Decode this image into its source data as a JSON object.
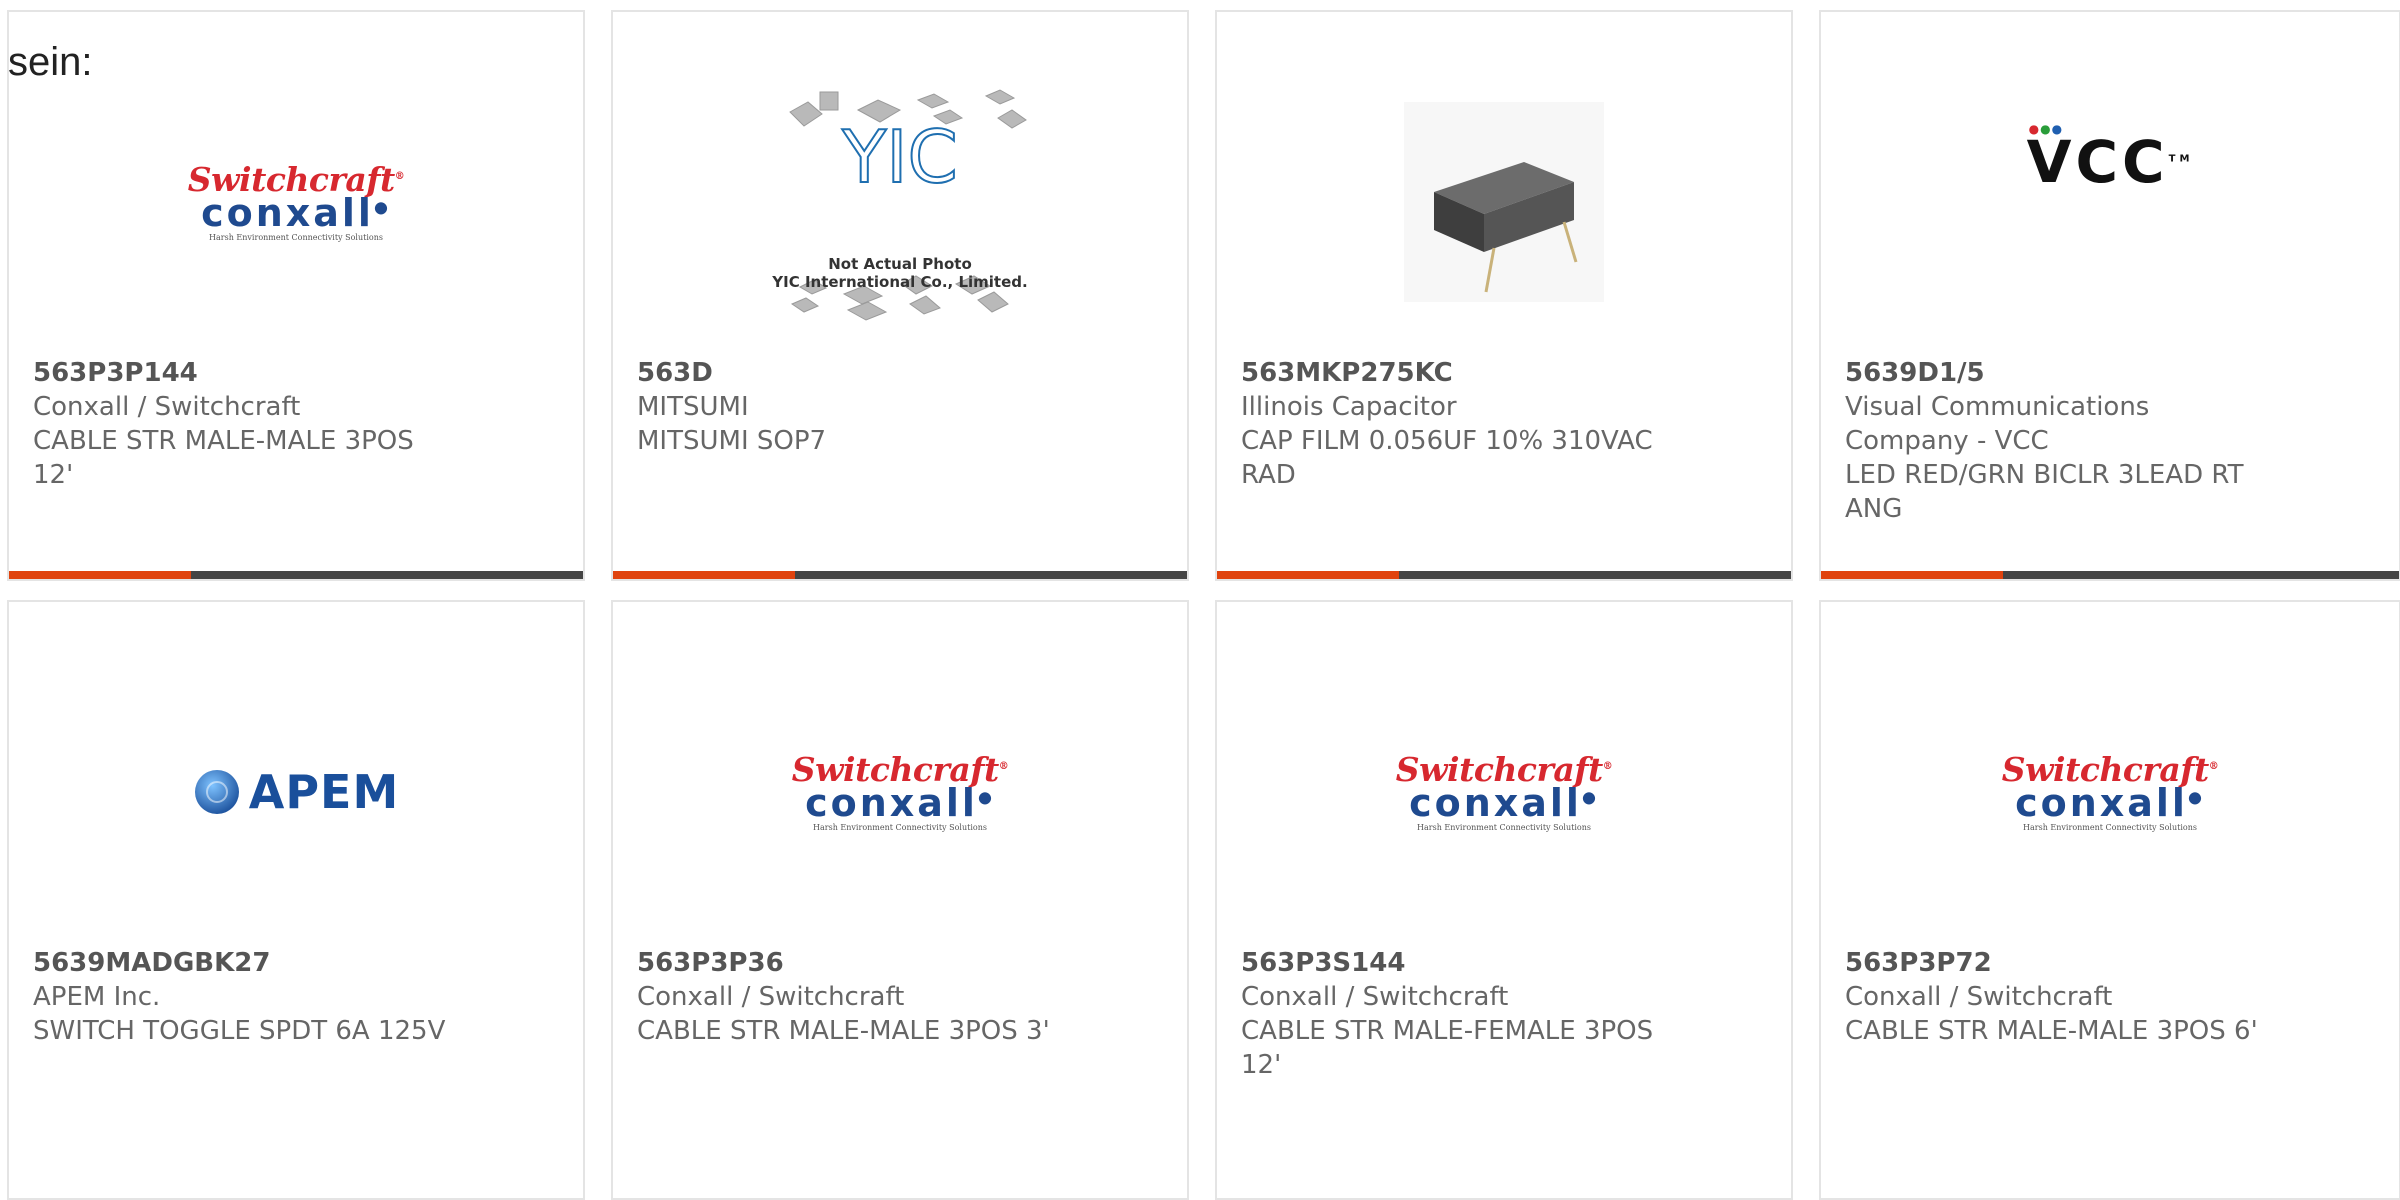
{
  "intro_text": "sein:",
  "products": [
    {
      "part": "563P3P144",
      "manufacturer": "Conxall / Switchcraft",
      "description": "CABLE STR MALE-MALE 3POS 12'",
      "logo": "switchcraft-conxall-logo"
    },
    {
      "part": "563D",
      "manufacturer": "MITSUMI",
      "description": "MITSUMI SOP7",
      "logo": "yic-placeholder-image"
    },
    {
      "part": "563MKP275KC",
      "manufacturer": "Illinois Capacitor",
      "description": "CAP FILM 0.056UF 10% 310VAC RAD",
      "logo": "film-capacitor-photo"
    },
    {
      "part": "5639D1/5",
      "manufacturer": "Visual Communications Company - VCC",
      "description": "LED RED/GRN BICLR 3LEAD RT ANG",
      "logo": "vcc-logo"
    },
    {
      "part": "5639MADGBK27",
      "manufacturer": "APEM Inc.",
      "description": "SWITCH TOGGLE SPDT 6A 125V",
      "logo": "apem-logo"
    },
    {
      "part": "563P3P36",
      "manufacturer": "Conxall / Switchcraft",
      "description": "CABLE STR MALE-MALE 3POS 3'",
      "logo": "switchcraft-conxall-logo"
    },
    {
      "part": "563P3S144",
      "manufacturer": "Conxall / Switchcraft",
      "description": "CABLE STR MALE-FEMALE 3POS 12'",
      "logo": "switchcraft-conxall-logo"
    },
    {
      "part": "563P3P72",
      "manufacturer": "Conxall / Switchcraft",
      "description": "CABLE STR MALE-MALE 3POS 6'",
      "logo": "switchcraft-conxall-logo"
    }
  ],
  "logos": {
    "switchcraft": {
      "line1": "Switchcraft",
      "line2": "conxall",
      "tagline": "Harsh Environment Connectivity Solutions"
    },
    "yic": {
      "mark": "YIC",
      "caption1": "Not Actual Photo",
      "caption2": "YIC International Co., Limited."
    },
    "vcc": {
      "text": "VCC",
      "tm": "TM"
    },
    "apem": {
      "text": "APEM"
    }
  },
  "colors": {
    "accent": "#e0430e",
    "bar": "#444444",
    "card_border": "#e4e4e4",
    "switchcraft_red": "#d7282f",
    "conxall_blue": "#1f4a8f",
    "apem_blue": "#1a4f9b"
  }
}
